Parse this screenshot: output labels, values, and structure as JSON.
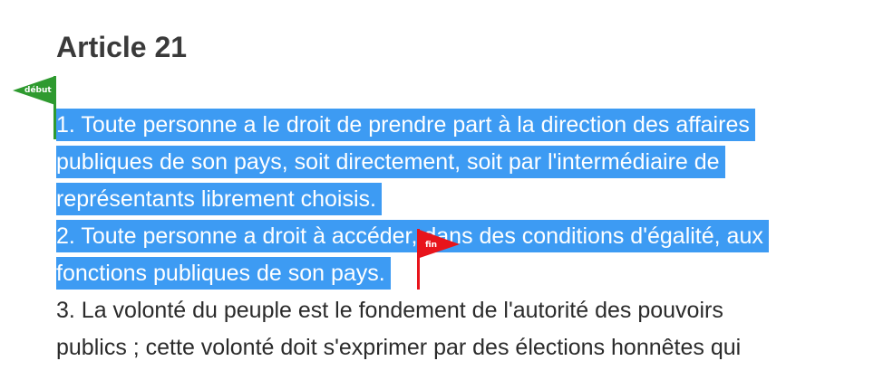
{
  "article": {
    "title": "Article 21"
  },
  "paragraphs": [
    {
      "lines": [
        "1. Toute personne a le droit de prendre part à la direction des affaires",
        "publiques de son pays, soit directement, soit par l'intermédiaire de",
        "représentants librement choisis."
      ]
    },
    {
      "lines": [
        "2. Toute personne a droit à accéder, dans des conditions d'égalité, aux",
        "fonctions publiques de son pays."
      ]
    },
    {
      "lines": [
        "3. La volonté du peuple est le fondement de l'autorité des pouvoirs",
        "publics ; cette volonté doit s'exprimer par des élections honnêtes qui"
      ]
    }
  ],
  "markers": {
    "start": {
      "label": "début",
      "color": "#2e9a2f"
    },
    "end": {
      "label": "fin",
      "color": "#e8141b"
    }
  },
  "selection": {
    "color": "#3d9bf3"
  }
}
